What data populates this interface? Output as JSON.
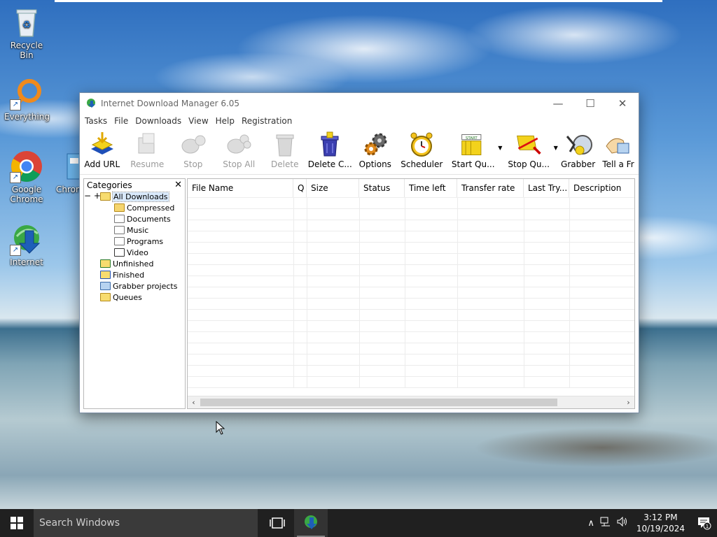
{
  "desktop": {
    "icons": [
      {
        "label": "Recycle Bin"
      },
      {
        "label": "Everything"
      },
      {
        "label": "Google Chrome"
      },
      {
        "label": "Chron"
      },
      {
        "label": "Internet"
      }
    ]
  },
  "window": {
    "title": "Internet Download Manager 6.05",
    "controls": {
      "minimize": "—",
      "maximize": "☐",
      "close": "✕"
    }
  },
  "menu": [
    "Tasks",
    "File",
    "Downloads",
    "View",
    "Help",
    "Registration"
  ],
  "toolbar": [
    {
      "label": "Add URL",
      "icon": "add-url-icon",
      "enabled": true
    },
    {
      "label": "Resume",
      "icon": "resume-icon",
      "enabled": false
    },
    {
      "label": "Stop",
      "icon": "stop-icon",
      "enabled": false
    },
    {
      "label": "Stop All",
      "icon": "stop-all-icon",
      "enabled": false
    },
    {
      "label": "Delete",
      "icon": "delete-icon",
      "enabled": false
    },
    {
      "label": "Delete C...",
      "icon": "delete-completed-icon",
      "enabled": true
    },
    {
      "label": "Options",
      "icon": "options-icon",
      "enabled": true
    },
    {
      "label": "Scheduler",
      "icon": "scheduler-icon",
      "enabled": true
    },
    {
      "label": "Start Qu...",
      "icon": "start-queue-icon",
      "enabled": true,
      "dropdown": true
    },
    {
      "label": "Stop Qu...",
      "icon": "stop-queue-icon",
      "enabled": true,
      "dropdown": true
    },
    {
      "label": "Grabber",
      "icon": "grabber-icon",
      "enabled": true
    },
    {
      "label": "Tell a Fr",
      "icon": "tell-a-friend-icon",
      "enabled": true
    }
  ],
  "categories": {
    "header": "Categories",
    "close": "✕",
    "tree": {
      "all_downloads": "All Downloads",
      "compressed": "Compressed",
      "documents": "Documents",
      "music": "Music",
      "programs": "Programs",
      "video": "Video",
      "unfinished": "Unfinished",
      "finished": "Finished",
      "grabber_projects": "Grabber projects",
      "queues": "Queues"
    }
  },
  "list": {
    "columns": [
      "File Name",
      "Q",
      "Size",
      "Status",
      "Time left",
      "Transfer rate",
      "Last Try...",
      "Description"
    ],
    "rows": []
  },
  "taskbar": {
    "search_placeholder": "Search Windows",
    "time": "3:12 PM",
    "date": "10/19/2024",
    "notification_count": "1"
  }
}
